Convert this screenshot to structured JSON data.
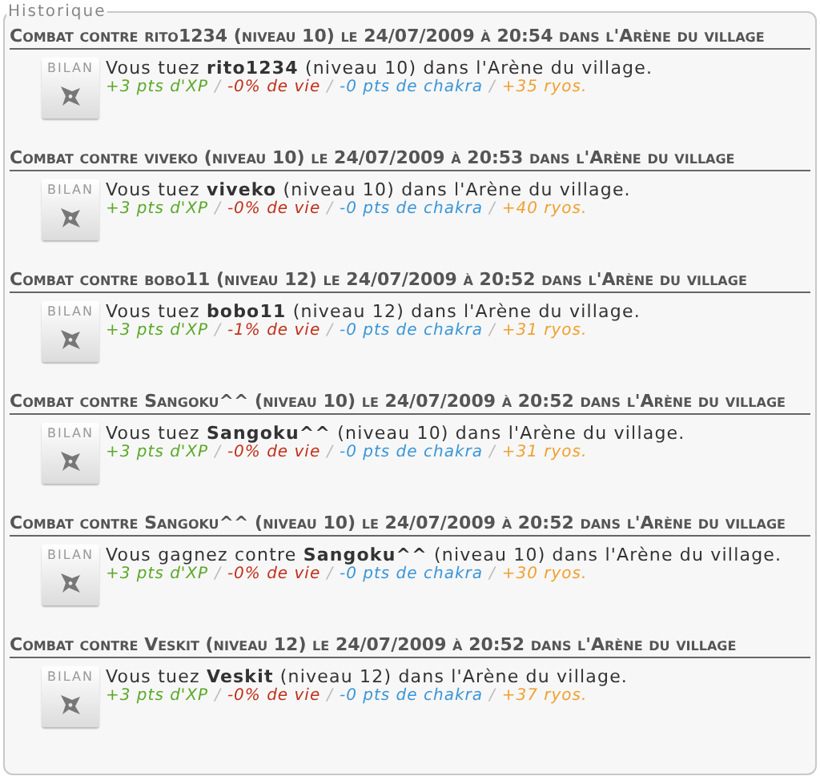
{
  "panel": {
    "legend": "Historique"
  },
  "entries": [
    {
      "title": "Combat contre rito1234 (niveau 10) le 24/07/2009 à 20:54 dans l'Arène du village",
      "badge": "BILAN",
      "summary": "Vous tuez **rito1234** (niveau 10) dans l'Arène du village.",
      "stats": [
        {
          "kind": "xp",
          "text": "+3 pts d'XP"
        },
        {
          "kind": "sep",
          "text": "/"
        },
        {
          "kind": "life",
          "text": "-0% de vie"
        },
        {
          "kind": "sep",
          "text": "/"
        },
        {
          "kind": "chakra",
          "text": "-0 pts de chakra"
        },
        {
          "kind": "sep",
          "text": "/"
        },
        {
          "kind": "ryos",
          "text": "+35 ryos."
        }
      ]
    },
    {
      "title": "Combat contre viveko (niveau 10) le 24/07/2009 à 20:53 dans l'Arène du village",
      "badge": "BILAN",
      "summary": "Vous tuez **viveko** (niveau 10) dans l'Arène du village.",
      "stats": [
        {
          "kind": "xp",
          "text": "+3 pts d'XP"
        },
        {
          "kind": "sep",
          "text": "/"
        },
        {
          "kind": "life",
          "text": "-0% de vie"
        },
        {
          "kind": "sep",
          "text": "/"
        },
        {
          "kind": "chakra",
          "text": "-0 pts de chakra"
        },
        {
          "kind": "sep",
          "text": "/"
        },
        {
          "kind": "ryos",
          "text": "+40 ryos."
        }
      ]
    },
    {
      "title": "Combat contre bobo11 (niveau 12) le 24/07/2009 à 20:52 dans l'Arène du village",
      "badge": "BILAN",
      "summary": "Vous tuez **bobo11** (niveau 12) dans l'Arène du village.",
      "stats": [
        {
          "kind": "xp",
          "text": "+3 pts d'XP"
        },
        {
          "kind": "sep",
          "text": "/"
        },
        {
          "kind": "life",
          "text": "-1% de vie"
        },
        {
          "kind": "sep",
          "text": "/"
        },
        {
          "kind": "chakra",
          "text": "-0 pts de chakra"
        },
        {
          "kind": "sep",
          "text": "/"
        },
        {
          "kind": "ryos",
          "text": "+31 ryos."
        }
      ]
    },
    {
      "title": "Combat contre Sangoku^^ (niveau 10) le 24/07/2009 à 20:52 dans l'Arène du village",
      "badge": "BILAN",
      "summary": "Vous tuez **Sangoku^^** (niveau 10) dans l'Arène du village.",
      "stats": [
        {
          "kind": "xp",
          "text": "+3 pts d'XP"
        },
        {
          "kind": "sep",
          "text": "/"
        },
        {
          "kind": "life",
          "text": "-0% de vie"
        },
        {
          "kind": "sep",
          "text": "/"
        },
        {
          "kind": "chakra",
          "text": "-0 pts de chakra"
        },
        {
          "kind": "sep",
          "text": "/"
        },
        {
          "kind": "ryos",
          "text": "+31 ryos."
        }
      ]
    },
    {
      "title": "Combat contre Sangoku^^ (niveau 10) le 24/07/2009 à 20:52 dans l'Arène du village",
      "badge": "BILAN",
      "summary": "Vous gagnez contre **Sangoku^^** (niveau 10) dans l'Arène du village.",
      "stats": [
        {
          "kind": "xp",
          "text": "+3 pts d'XP"
        },
        {
          "kind": "sep",
          "text": "/"
        },
        {
          "kind": "life",
          "text": "-0% de vie"
        },
        {
          "kind": "sep",
          "text": "/"
        },
        {
          "kind": "chakra",
          "text": "-0 pts de chakra"
        },
        {
          "kind": "sep",
          "text": "/"
        },
        {
          "kind": "ryos",
          "text": "+30 ryos."
        }
      ]
    },
    {
      "title": "Combat contre Veskit (niveau 12) le 24/07/2009 à 20:52 dans l'Arène du village",
      "badge": "BILAN",
      "summary": "Vous tuez **Veskit** (niveau 12) dans l'Arène du village.",
      "stats": [
        {
          "kind": "xp",
          "text": "+3 pts d'XP"
        },
        {
          "kind": "sep",
          "text": "/"
        },
        {
          "kind": "life",
          "text": "-0% de vie"
        },
        {
          "kind": "sep",
          "text": "/"
        },
        {
          "kind": "chakra",
          "text": "-0 pts de chakra"
        },
        {
          "kind": "sep",
          "text": "/"
        },
        {
          "kind": "ryos",
          "text": "+37 ryos."
        }
      ]
    }
  ]
}
